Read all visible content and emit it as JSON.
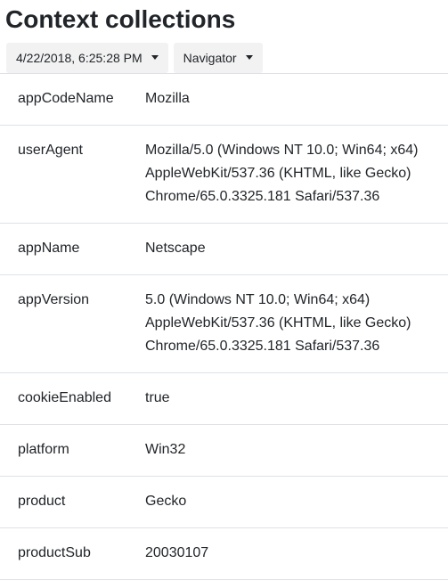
{
  "page": {
    "title": "Context collections"
  },
  "toolbar": {
    "timestamp_label": "4/22/2018, 6:25:28 PM",
    "collection_label": "Navigator"
  },
  "table": {
    "rows": [
      {
        "key": "appCodeName",
        "value": "Mozilla"
      },
      {
        "key": "userAgent",
        "value": "Mozilla/5.0 (Windows NT 10.0; Win64; x64)\nAppleWebKit/537.36 (KHTML, like Gecko)\nChrome/65.0.3325.181 Safari/537.36"
      },
      {
        "key": "appName",
        "value": "Netscape"
      },
      {
        "key": "appVersion",
        "value": "5.0 (Windows NT 10.0; Win64; x64)\nAppleWebKit/537.36 (KHTML, like Gecko)\nChrome/65.0.3325.181 Safari/537.36"
      },
      {
        "key": "cookieEnabled",
        "value": "true"
      },
      {
        "key": "platform",
        "value": "Win32"
      },
      {
        "key": "product",
        "value": "Gecko"
      },
      {
        "key": "productSub",
        "value": "20030107"
      }
    ]
  }
}
